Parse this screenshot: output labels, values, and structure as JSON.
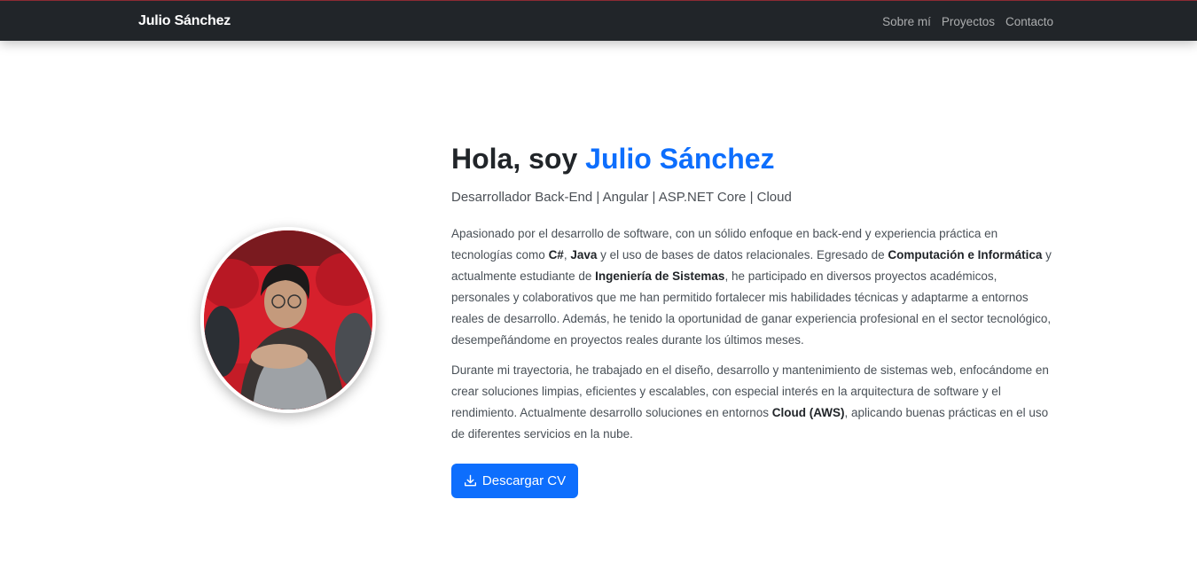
{
  "nav": {
    "brand": "Julio Sánchez",
    "links": [
      "Sobre mí",
      "Proyectos",
      "Contacto"
    ]
  },
  "hero": {
    "greeting": "Hola, soy ",
    "name": "Julio Sánchez",
    "subtitle": "Desarrollador Back-End | Angular | ASP.NET Core | Cloud",
    "paragraph1": {
      "t1": "Apasionado por el desarrollo de software, con un sólido enfoque en back-end y experiencia práctica en tecnologías como ",
      "b1": "C#",
      "t2": ", ",
      "b2": "Java",
      "t3": " y el uso de bases de datos relacionales. Egresado de ",
      "b3": "Computación e Informática",
      "t4": " y actualmente estudiante de ",
      "b4": "Ingeniería de Sistemas",
      "t5": ", he participado en diversos proyectos académicos, personales y colaborativos que me han permitido fortalecer mis habilidades técnicas y adaptarme a entornos reales de desarrollo. Además, he tenido la oportunidad de ganar experiencia profesional en el sector tecnológico, desempeñándome en proyectos reales durante los últimos meses."
    },
    "paragraph2": {
      "t1": "Durante mi trayectoria, he trabajado en el diseño, desarrollo y mantenimiento de sistemas web, enfocándome en crear soluciones limpias, eficientes y escalables, con especial interés en la arquitectura de software y el rendimiento. Actualmente desarrollo soluciones en entornos ",
      "b1": "Cloud (AWS)",
      "t2": ", aplicando buenas prácticas en el uso de diferentes servicios en la nube."
    },
    "cv_button": "Descargar CV",
    "cv_icon": "download-icon",
    "profile_image": "profile-photo"
  },
  "colors": {
    "navbar_bg": "#212529",
    "accent": "#0d6efd",
    "seats_red": "#d8222d"
  }
}
